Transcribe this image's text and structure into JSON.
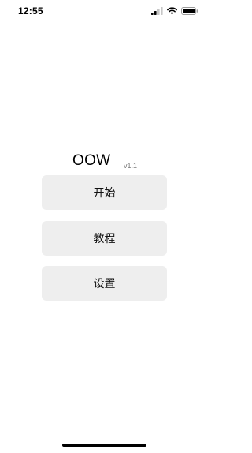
{
  "status_bar": {
    "time": "12:55",
    "icons": [
      "signal-icon",
      "wifi-icon",
      "battery-icon"
    ]
  },
  "app": {
    "title": "OOW",
    "version": "v1.1"
  },
  "menu": {
    "start_label": "开始",
    "tutorial_label": "教程",
    "settings_label": "设置"
  },
  "colors": {
    "background": "#ffffff",
    "button_bg": "#eeeeee",
    "text": "#111111",
    "version_text": "#7a7a7a"
  }
}
